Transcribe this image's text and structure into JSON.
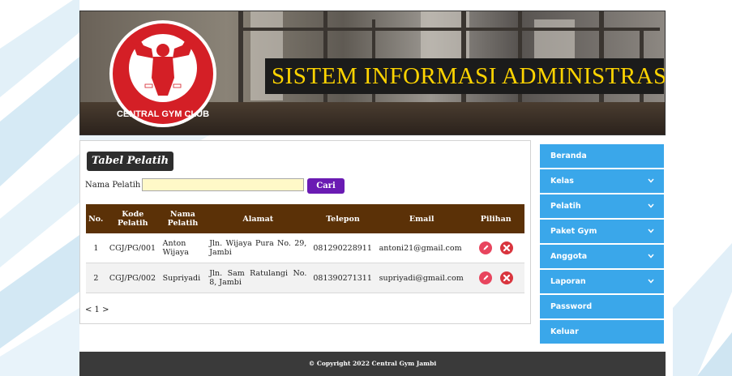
{
  "header": {
    "site_title": "SISTEM INFORMASI ADMINISTRASI",
    "logo_text": "CENTRAL GYM CLUB"
  },
  "panel": {
    "title": "Tabel Pelatih",
    "search": {
      "label": "Nama Pelatih :",
      "value": "",
      "placeholder": "",
      "button_label": "Cari"
    },
    "table": {
      "headers": {
        "no": "No.",
        "kode_1": "Kode",
        "kode_2": "Pelatih",
        "nama_1": "Nama",
        "nama_2": "Pelatih",
        "alamat": "Alamat",
        "telepon": "Telepon",
        "email": "Email",
        "pilihan": "Pilihan"
      },
      "rows": [
        {
          "no": "1",
          "kode": "CGJ/PG/001",
          "nama": "Anton Wijaya",
          "alamat": "Jln. Wijaya Pura No. 29, Jambi",
          "telepon": "081290228911",
          "email": "antoni21@gmail.com"
        },
        {
          "no": "2",
          "kode": "CGJ/PG/002",
          "nama": "Supriyadi",
          "alamat": "Jln. Sam Ratulangi No. 8, Jambi",
          "telepon": "081390271311",
          "email": "supriyadi@gmail.com"
        }
      ]
    },
    "pager": "< 1 >"
  },
  "sidebar": {
    "items": [
      {
        "label": "Beranda",
        "has_submenu": false
      },
      {
        "label": "Kelas",
        "has_submenu": true
      },
      {
        "label": "Pelatih",
        "has_submenu": true
      },
      {
        "label": "Paket Gym",
        "has_submenu": true
      },
      {
        "label": "Anggota",
        "has_submenu": true
      },
      {
        "label": "Laporan",
        "has_submenu": true
      },
      {
        "label": "Password",
        "has_submenu": false
      },
      {
        "label": "Keluar",
        "has_submenu": false
      }
    ]
  },
  "footer": {
    "text": "© Copyright 2022 Central Gym Jambi"
  },
  "colors": {
    "title_yellow": "#ffd400",
    "table_header_brown": "#5b3107",
    "search_button_purple": "#6a1bb3",
    "sidebar_blue": "#3aa7ea",
    "logo_red": "#d41f26",
    "edit_icon": "#e8455e",
    "delete_icon": "#d9353e"
  },
  "icons": {
    "edit": "pencil-circle-icon",
    "delete": "x-circle-icon",
    "submenu": "chevron-down-icon"
  }
}
